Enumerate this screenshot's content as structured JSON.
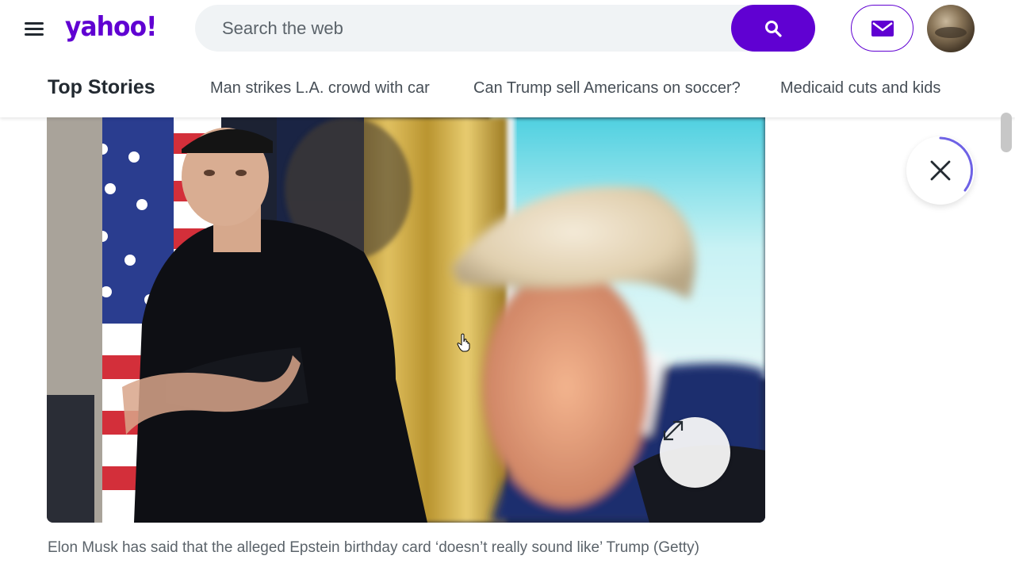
{
  "header": {
    "logo_text": "yahoo!",
    "search": {
      "placeholder": "Search the web",
      "value": ""
    },
    "icons": {
      "menu": "hamburger-icon",
      "search": "search-icon",
      "mail": "mail-icon"
    }
  },
  "nav": {
    "title": "Top Stories",
    "links": [
      "Man strikes L.A. crowd with car",
      "Can Trump sell Americans on soccer?",
      "Medicaid cuts and kids"
    ]
  },
  "article": {
    "caption": "Elon Musk has said that the alleged Epstein birthday card ‘doesn’t really sound like’ Trump (Getty)",
    "icons": {
      "expand": "expand-icon",
      "close": "close-icon"
    }
  },
  "colors": {
    "brand": "#6001d2",
    "text_primary": "#232a31",
    "text_secondary": "#5b636a",
    "search_bg": "#f0f3f5"
  }
}
